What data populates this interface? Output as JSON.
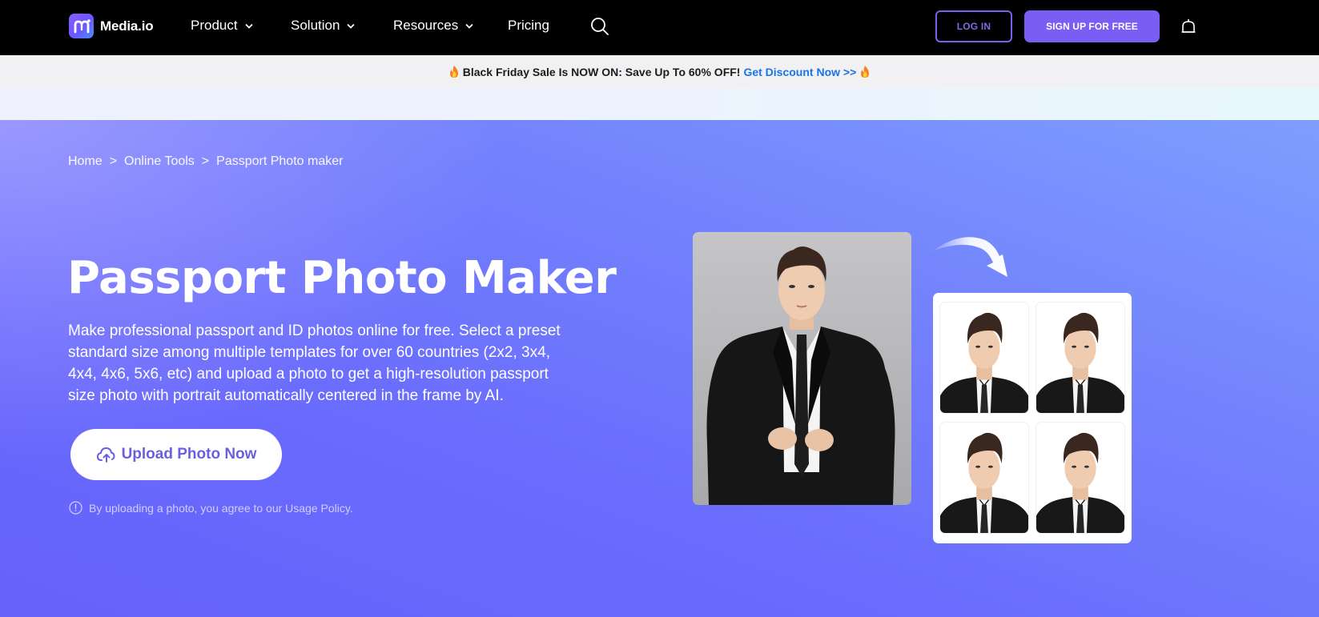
{
  "brand": {
    "name": "Media.io",
    "logo_icon": "media-io-logo",
    "colors": {
      "accent": "#7a5ef4",
      "promo_link": "#1a73e8",
      "nav_bg": "#000000",
      "hero_bg": "#6a68fb"
    }
  },
  "nav": {
    "items": [
      {
        "label": "Product",
        "has_dropdown": true
      },
      {
        "label": "Solution",
        "has_dropdown": true
      },
      {
        "label": "Resources",
        "has_dropdown": true
      },
      {
        "label": "Pricing",
        "has_dropdown": false
      }
    ],
    "search_icon": "search-icon",
    "login_label": "LOG IN",
    "signup_label": "SIGN UP FOR FREE",
    "bell_icon": "bell-icon"
  },
  "promo": {
    "icon": "fire-emoji",
    "text": "Black Friday Sale Is NOW ON: Save Up To 60% OFF!",
    "link_label": "Get Discount Now >>"
  },
  "breadcrumb": {
    "items": [
      "Home",
      "Online Tools",
      "Passport Photo maker"
    ],
    "separator": ">"
  },
  "hero": {
    "title": "Passport Photo Maker",
    "description": "Make professional passport and ID photos online for free. Select a preset standard size among multiple templates for over 60 countries (2x2, 3x4, 4x4, 4x6, 5x6, etc) and upload a photo to get a high-resolution passport size photo with portrait automatically centered in the frame by AI.",
    "upload_label": "Upload Photo Now",
    "upload_icon": "cloud-upload-icon",
    "policy_icon": "info-icon",
    "policy_text": "By uploading a photo, you agree to our Usage Policy."
  },
  "illustration": {
    "original_photo": "man-in-suit-photo",
    "arrow_icon": "curved-arrow-icon",
    "result_photos_count": 4
  }
}
